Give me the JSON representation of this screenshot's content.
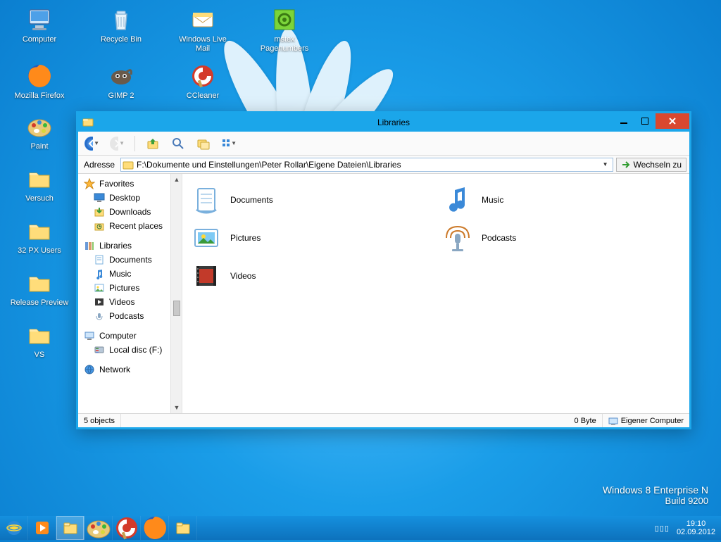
{
  "desktop": {
    "row": [
      {
        "label": "Computer",
        "icon": "computer"
      },
      {
        "label": "Recycle Bin",
        "icon": "recycle"
      },
      {
        "label": "Windows Live Mail",
        "icon": "mail"
      },
      {
        "label": "mstex Pagenumbers",
        "icon": "gear-green"
      }
    ],
    "row2": [
      {
        "label": "Mozilla Firefox",
        "icon": "firefox"
      },
      {
        "label": "GIMP 2",
        "icon": "gimp"
      },
      {
        "label": "CCleaner",
        "icon": "ccleaner"
      }
    ],
    "left": [
      {
        "label": "Paint",
        "icon": "paint"
      },
      {
        "label": "Versuch",
        "icon": "folder"
      },
      {
        "label": "32 PX Users",
        "icon": "folder"
      },
      {
        "label": "Release Preview",
        "icon": "folder"
      },
      {
        "label": "VS",
        "icon": "folder"
      }
    ]
  },
  "watermark": {
    "line1": "Windows 8 Enterprise N",
    "line2": "Build 9200"
  },
  "taskbar": {
    "items": [
      {
        "icon": "ie"
      },
      {
        "icon": "media"
      },
      {
        "icon": "explorer",
        "active": true
      },
      {
        "icon": "paint"
      },
      {
        "icon": "ccleaner"
      },
      {
        "icon": "firefox"
      },
      {
        "icon": "explorer"
      }
    ],
    "time": "19:10",
    "date": "02.09.2012"
  },
  "window": {
    "title": "Libraries",
    "address_label": "Adresse",
    "address_path": "F:\\Dokumente und Einstellungen\\Peter Rollar\\Eigene Dateien\\Libraries",
    "go_label": "Wechseln zu",
    "sidebar": {
      "favorites": {
        "header": "Favorites",
        "items": [
          "Desktop",
          "Downloads",
          "Recent places"
        ]
      },
      "libraries": {
        "header": "Libraries",
        "items": [
          "Documents",
          "Music",
          "Pictures",
          "Videos",
          "Podcasts"
        ]
      },
      "computer": {
        "header": "Computer",
        "items": [
          "Local disc (F:)"
        ]
      },
      "network": {
        "header": "Network"
      }
    },
    "items": [
      {
        "label": "Documents",
        "icon": "documents"
      },
      {
        "label": "Music",
        "icon": "music"
      },
      {
        "label": "Pictures",
        "icon": "pictures"
      },
      {
        "label": "Podcasts",
        "icon": "podcasts"
      },
      {
        "label": "Videos",
        "icon": "videos"
      }
    ],
    "status": {
      "count": "5 objects",
      "size": "0 Byte",
      "location": "Eigener Computer"
    }
  }
}
